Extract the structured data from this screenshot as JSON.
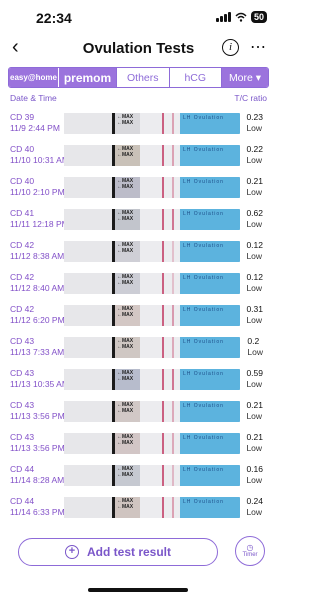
{
  "status": {
    "time": "22:34",
    "battery": "50"
  },
  "nav": {
    "title": "Ovulation Tests",
    "info_glyph": "i",
    "back_icon": "chevron-left-icon",
    "more_icon": "more-icon"
  },
  "tabs": [
    {
      "label": "easy@home"
    },
    {
      "label": "premom"
    },
    {
      "label": "Others"
    },
    {
      "label": "hCG"
    },
    {
      "label": "More ▾"
    }
  ],
  "header": {
    "left": "Date & Time",
    "right": "T/C ratio"
  },
  "rows": [
    {
      "cd": "CD 39",
      "date": "11/9 2:44 PM",
      "ratio": "0.23",
      "level": "Low",
      "line_color": "#c9587a",
      "line_opacity": 0.5,
      "bg": "#d8d8dc"
    },
    {
      "cd": "CD 40",
      "date": "11/10 10:31 AM",
      "ratio": "0.22",
      "level": "Low",
      "line_color": "#c9587a",
      "line_opacity": 0.5,
      "bg": "#c9c1b8"
    },
    {
      "cd": "CD 40",
      "date": "11/10 2:10 PM",
      "ratio": "0.21",
      "level": "Low",
      "line_color": "#c9587a",
      "line_opacity": 0.45,
      "bg": "#bcbcc9"
    },
    {
      "cd": "CD 41",
      "date": "11/11 12:18 PM",
      "ratio": "0.62",
      "level": "Low",
      "line_color": "#c9587a",
      "line_opacity": 0.8,
      "bg": "#c2c5cc"
    },
    {
      "cd": "CD 42",
      "date": "11/12 8:38 AM",
      "ratio": "0.12",
      "level": "Low",
      "line_color": "#c9587a",
      "line_opacity": 0.3,
      "bg": "#cfcfd6"
    },
    {
      "cd": "CD 42",
      "date": "11/12 8:40 AM",
      "ratio": "0.12",
      "level": "Low",
      "line_color": "#c9587a",
      "line_opacity": 0.3,
      "bg": "#cccdd5"
    },
    {
      "cd": "CD 42",
      "date": "11/12 6:20 PM",
      "ratio": "0.31",
      "level": "Low",
      "line_color": "#c9587a",
      "line_opacity": 0.55,
      "bg": "#d3c7c4"
    },
    {
      "cd": "CD 43",
      "date": "11/13 7:33 AM",
      "ratio": "0.2",
      "level": "Low",
      "line_color": "#c9587a",
      "line_opacity": 0.45,
      "bg": "#cfc7c3"
    },
    {
      "cd": "CD 43",
      "date": "11/13 10:35 AM",
      "ratio": "0.59",
      "level": "Low",
      "line_color": "#c9587a",
      "line_opacity": 0.8,
      "bg": "#b7bccc"
    },
    {
      "cd": "CD 43",
      "date": "11/13 3:56 PM",
      "ratio": "0.21",
      "level": "Low",
      "line_color": "#c9587a",
      "line_opacity": 0.45,
      "bg": "#d1c8c6"
    },
    {
      "cd": "CD 43",
      "date": "11/13 3:56 PM",
      "ratio": "0.21",
      "level": "Low",
      "line_color": "#c9587a",
      "line_opacity": 0.45,
      "bg": "#d2c6c6"
    },
    {
      "cd": "CD 44",
      "date": "11/14 8:28 AM",
      "ratio": "0.16",
      "level": "Low",
      "line_color": "#c9587a",
      "line_opacity": 0.35,
      "bg": "#c6c9d1"
    },
    {
      "cd": "CD 44",
      "date": "11/14 6:33 PM",
      "ratio": "0.24",
      "level": "Low",
      "line_color": "#c9587a",
      "line_opacity": 0.5,
      "bg": "#cfc4c0"
    }
  ],
  "strip_text": {
    "max_label": "MAX",
    "blue_label": "LH Ovulation"
  },
  "actions": {
    "add_label": "Add test result",
    "timer_label": "Timer"
  },
  "colors": {
    "accent": "#8e6bd8",
    "strip_blue": "#5cb3de"
  }
}
